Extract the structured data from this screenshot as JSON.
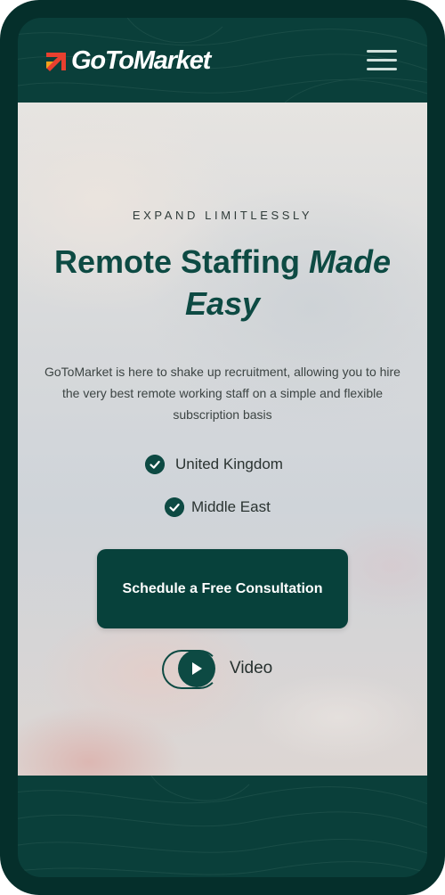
{
  "header": {
    "logo_text": "GoToMarket",
    "menu_icon": "hamburger-menu-icon"
  },
  "hero": {
    "eyebrow": "EXPAND LIMITLESSLY",
    "title_plain": "Remote Staffing ",
    "title_italic": "Made Easy",
    "description": "GoToMarket is here to shake up recruitment, allowing you to hire the very best remote working staff on a simple and flexible subscription basis",
    "locations": [
      {
        "label": "United Kingdom",
        "icon": "check-circle-icon"
      },
      {
        "label": "Middle East",
        "icon": "check-circle-icon"
      }
    ],
    "cta_label": "Schedule a Free Consultation",
    "video_label": "Video",
    "video_icon": "play-icon"
  },
  "colors": {
    "brand_dark": "#052f2b",
    "brand_green": "#0d4a43",
    "logo_red": "#e8402f",
    "logo_orange": "#f4a21c"
  }
}
